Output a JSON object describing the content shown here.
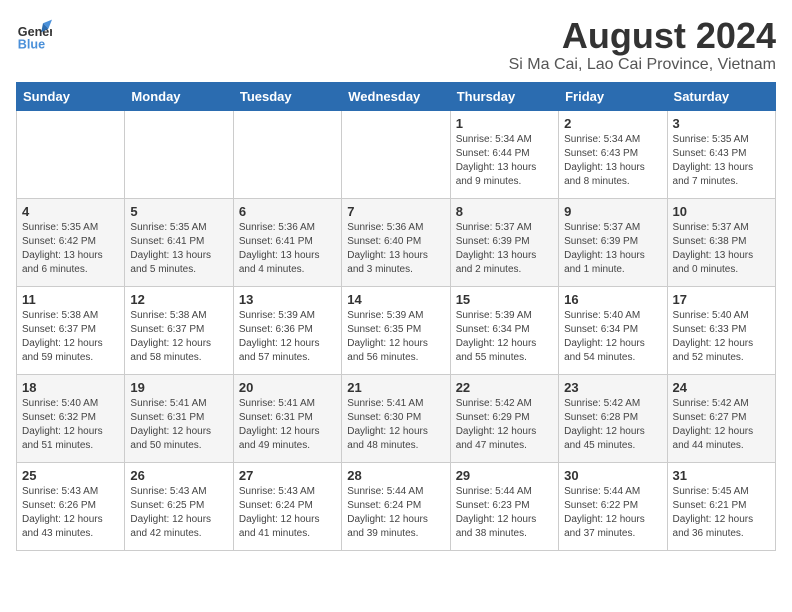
{
  "logo": {
    "text_general": "General",
    "text_blue": "Blue"
  },
  "header": {
    "title": "August 2024",
    "subtitle": "Si Ma Cai, Lao Cai Province, Vietnam"
  },
  "days_of_week": [
    "Sunday",
    "Monday",
    "Tuesday",
    "Wednesday",
    "Thursday",
    "Friday",
    "Saturday"
  ],
  "weeks": [
    [
      {
        "day": "",
        "info": ""
      },
      {
        "day": "",
        "info": ""
      },
      {
        "day": "",
        "info": ""
      },
      {
        "day": "",
        "info": ""
      },
      {
        "day": "1",
        "info": "Sunrise: 5:34 AM\nSunset: 6:44 PM\nDaylight: 13 hours\nand 9 minutes."
      },
      {
        "day": "2",
        "info": "Sunrise: 5:34 AM\nSunset: 6:43 PM\nDaylight: 13 hours\nand 8 minutes."
      },
      {
        "day": "3",
        "info": "Sunrise: 5:35 AM\nSunset: 6:43 PM\nDaylight: 13 hours\nand 7 minutes."
      }
    ],
    [
      {
        "day": "4",
        "info": "Sunrise: 5:35 AM\nSunset: 6:42 PM\nDaylight: 13 hours\nand 6 minutes."
      },
      {
        "day": "5",
        "info": "Sunrise: 5:35 AM\nSunset: 6:41 PM\nDaylight: 13 hours\nand 5 minutes."
      },
      {
        "day": "6",
        "info": "Sunrise: 5:36 AM\nSunset: 6:41 PM\nDaylight: 13 hours\nand 4 minutes."
      },
      {
        "day": "7",
        "info": "Sunrise: 5:36 AM\nSunset: 6:40 PM\nDaylight: 13 hours\nand 3 minutes."
      },
      {
        "day": "8",
        "info": "Sunrise: 5:37 AM\nSunset: 6:39 PM\nDaylight: 13 hours\nand 2 minutes."
      },
      {
        "day": "9",
        "info": "Sunrise: 5:37 AM\nSunset: 6:39 PM\nDaylight: 13 hours\nand 1 minute."
      },
      {
        "day": "10",
        "info": "Sunrise: 5:37 AM\nSunset: 6:38 PM\nDaylight: 13 hours\nand 0 minutes."
      }
    ],
    [
      {
        "day": "11",
        "info": "Sunrise: 5:38 AM\nSunset: 6:37 PM\nDaylight: 12 hours\nand 59 minutes."
      },
      {
        "day": "12",
        "info": "Sunrise: 5:38 AM\nSunset: 6:37 PM\nDaylight: 12 hours\nand 58 minutes."
      },
      {
        "day": "13",
        "info": "Sunrise: 5:39 AM\nSunset: 6:36 PM\nDaylight: 12 hours\nand 57 minutes."
      },
      {
        "day": "14",
        "info": "Sunrise: 5:39 AM\nSunset: 6:35 PM\nDaylight: 12 hours\nand 56 minutes."
      },
      {
        "day": "15",
        "info": "Sunrise: 5:39 AM\nSunset: 6:34 PM\nDaylight: 12 hours\nand 55 minutes."
      },
      {
        "day": "16",
        "info": "Sunrise: 5:40 AM\nSunset: 6:34 PM\nDaylight: 12 hours\nand 54 minutes."
      },
      {
        "day": "17",
        "info": "Sunrise: 5:40 AM\nSunset: 6:33 PM\nDaylight: 12 hours\nand 52 minutes."
      }
    ],
    [
      {
        "day": "18",
        "info": "Sunrise: 5:40 AM\nSunset: 6:32 PM\nDaylight: 12 hours\nand 51 minutes."
      },
      {
        "day": "19",
        "info": "Sunrise: 5:41 AM\nSunset: 6:31 PM\nDaylight: 12 hours\nand 50 minutes."
      },
      {
        "day": "20",
        "info": "Sunrise: 5:41 AM\nSunset: 6:31 PM\nDaylight: 12 hours\nand 49 minutes."
      },
      {
        "day": "21",
        "info": "Sunrise: 5:41 AM\nSunset: 6:30 PM\nDaylight: 12 hours\nand 48 minutes."
      },
      {
        "day": "22",
        "info": "Sunrise: 5:42 AM\nSunset: 6:29 PM\nDaylight: 12 hours\nand 47 minutes."
      },
      {
        "day": "23",
        "info": "Sunrise: 5:42 AM\nSunset: 6:28 PM\nDaylight: 12 hours\nand 45 minutes."
      },
      {
        "day": "24",
        "info": "Sunrise: 5:42 AM\nSunset: 6:27 PM\nDaylight: 12 hours\nand 44 minutes."
      }
    ],
    [
      {
        "day": "25",
        "info": "Sunrise: 5:43 AM\nSunset: 6:26 PM\nDaylight: 12 hours\nand 43 minutes."
      },
      {
        "day": "26",
        "info": "Sunrise: 5:43 AM\nSunset: 6:25 PM\nDaylight: 12 hours\nand 42 minutes."
      },
      {
        "day": "27",
        "info": "Sunrise: 5:43 AM\nSunset: 6:24 PM\nDaylight: 12 hours\nand 41 minutes."
      },
      {
        "day": "28",
        "info": "Sunrise: 5:44 AM\nSunset: 6:24 PM\nDaylight: 12 hours\nand 39 minutes."
      },
      {
        "day": "29",
        "info": "Sunrise: 5:44 AM\nSunset: 6:23 PM\nDaylight: 12 hours\nand 38 minutes."
      },
      {
        "day": "30",
        "info": "Sunrise: 5:44 AM\nSunset: 6:22 PM\nDaylight: 12 hours\nand 37 minutes."
      },
      {
        "day": "31",
        "info": "Sunrise: 5:45 AM\nSunset: 6:21 PM\nDaylight: 12 hours\nand 36 minutes."
      }
    ]
  ]
}
